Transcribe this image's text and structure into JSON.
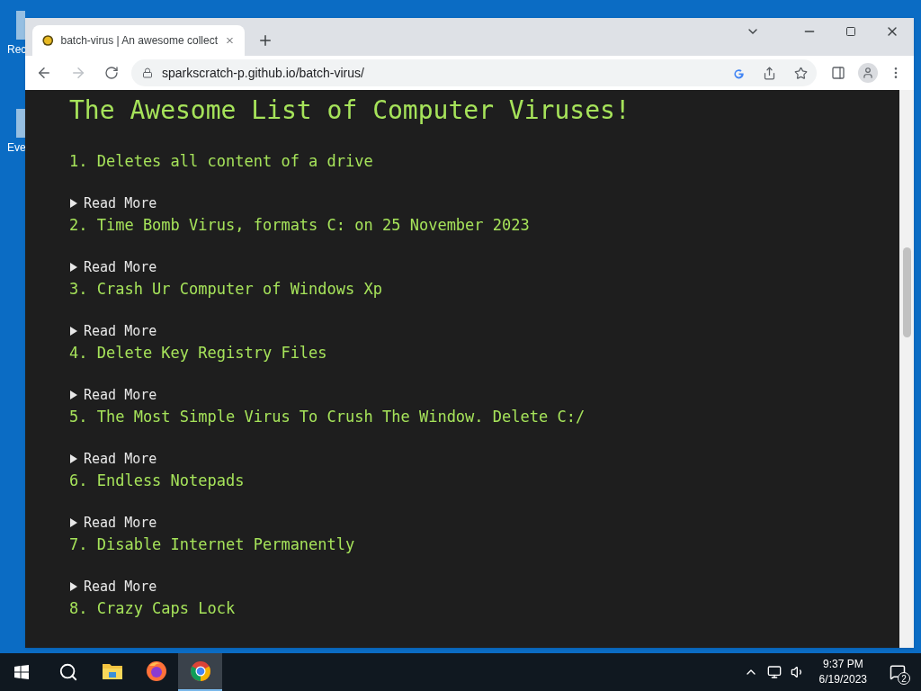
{
  "desktop_icons": [
    {
      "label": "Rec"
    },
    {
      "label": "Eve"
    }
  ],
  "browser": {
    "tab": {
      "title": "batch-virus | An awesome collect",
      "selected": true
    },
    "address": "sparkscratch-p.github.io/batch-virus/"
  },
  "page": {
    "heading": "The Awesome List of Computer Viruses!",
    "items": [
      {
        "title": "1. Deletes all content of a drive",
        "summary": "Read More",
        "expanded": false
      },
      {
        "title": "2. Time Bomb Virus, formats C: on 25 November 2023",
        "summary": "Read More",
        "expanded": false
      },
      {
        "title": "3. Crash Ur Computer of Windows Xp",
        "summary": "Read More",
        "expanded": false
      },
      {
        "title": "4. Delete Key Registry Files",
        "summary": "Read More",
        "expanded": false
      },
      {
        "title": "5. The Most Simple Virus To Crush The Window. Delete C:/",
        "summary": "Read More",
        "expanded": false
      },
      {
        "title": "6. Endless Notepads",
        "summary": "Read More",
        "expanded": false
      },
      {
        "title": "7. Disable Internet Permanently",
        "summary": "Read More",
        "expanded": false
      },
      {
        "title": "8. Crazy Caps Lock"
      }
    ]
  },
  "taskbar": {
    "apps": [
      {
        "kind": "folder",
        "selected": false
      },
      {
        "kind": "firefox",
        "selected": false
      },
      {
        "kind": "chrome",
        "selected": true
      }
    ],
    "time": "9:37 PM",
    "date": "6/19/2023",
    "notifications": "2"
  }
}
